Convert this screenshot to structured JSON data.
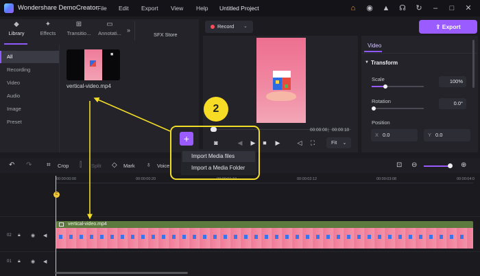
{
  "app": {
    "name": "Wondershare DemoCreator",
    "project": "Untitled Project"
  },
  "menu": [
    "File",
    "Edit",
    "Export",
    "View",
    "Help"
  ],
  "library": {
    "tabs": [
      {
        "label": "Library",
        "icon": "layers-icon"
      },
      {
        "label": "Effects",
        "icon": "sparkle-icon"
      },
      {
        "label": "Transitio...",
        "icon": "transition-icon"
      },
      {
        "label": "Annotati...",
        "icon": "annotation-icon"
      }
    ],
    "more": "»",
    "sfx_store": "SFX Store",
    "sidebar": [
      "All",
      "Recording",
      "Video",
      "Audio",
      "Image",
      "Preset"
    ],
    "media_item": "vertical-video.mp4"
  },
  "record": {
    "label": "Record"
  },
  "preview": {
    "time_current": "00:00:00",
    "time_total": "00:00:10",
    "fit": "Fit"
  },
  "export": {
    "label": "Export"
  },
  "properties": {
    "tab": "Video",
    "section": "Transform",
    "scale_label": "Scale",
    "scale_value": "100%",
    "rotation_label": "Rotation",
    "rotation_value": "0.0°",
    "position_label": "Position",
    "x_axis": "X",
    "x_value": "0.0",
    "y_axis": "Y",
    "y_value": "0.0"
  },
  "toolbar": {
    "crop": "Crop",
    "split": "Split",
    "mark": "Mark",
    "voice": "Voice"
  },
  "timeline": {
    "ruler": [
      "00:00:00:00",
      "00:00:00:20",
      "00:00:01:10",
      "00:00:02:12",
      "00:00:03:08",
      "00:00:04:0"
    ],
    "playhead_badge": "C",
    "tracks": [
      "02",
      "01"
    ],
    "clip_name": "vertical-video.mp4"
  },
  "import_menu": {
    "plus": "+",
    "items": [
      "Import Media files",
      "Import a Media Folder"
    ]
  },
  "annotation": {
    "step": "2"
  },
  "colors": {
    "accent": "#9b5cff",
    "highlight": "#f2dc28"
  }
}
